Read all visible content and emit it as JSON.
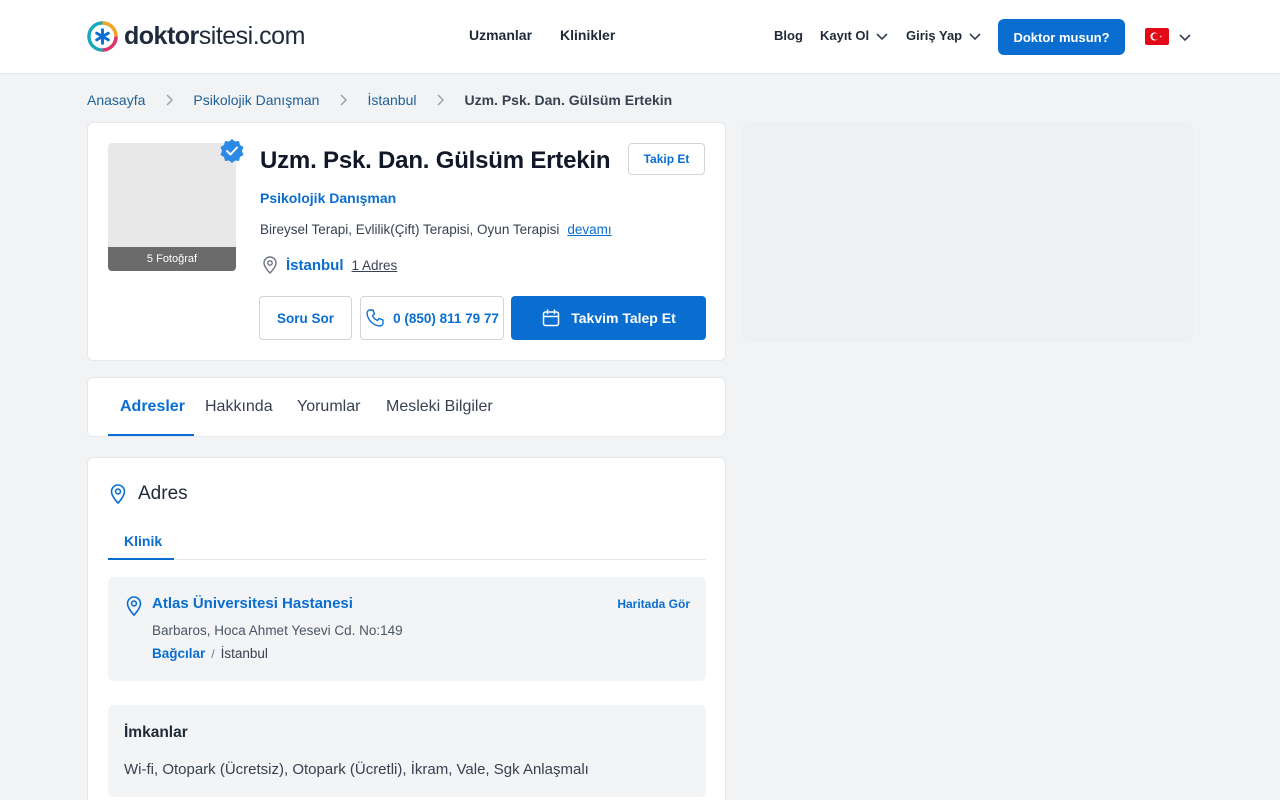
{
  "header": {
    "logo_bold": "doktor",
    "logo_thin": "sitesi.com",
    "nav_center": [
      "Uzmanlar",
      "Klinikler"
    ],
    "blog": "Blog",
    "register": "Kayıt Ol",
    "login": "Giriş Yap",
    "cta": "Doktor musun?",
    "language_flag": "tr-flag",
    "colors": {
      "brand": "#0a6ed1",
      "flag": "#e30a17"
    }
  },
  "breadcrumb": {
    "items": [
      "Anasayfa",
      "Psikolojik Danışman",
      "İstanbul"
    ],
    "current": "Uzm. Psk. Dan. Gülsüm Ertekin"
  },
  "profile": {
    "photo_count_label": "5 Fotoğraf",
    "name": "Uzm. Psk. Dan. Gülsüm Ertekin",
    "follow_label": "Takip Et",
    "specialty": "Psikolojik Danışman",
    "therapies": "Bireysel Terapi, Evlilik(Çift) Terapisi, Oyun Terapisi",
    "more_label": "devamı",
    "city": "İstanbul",
    "address_count": "1 Adres",
    "ask_label": "Soru Sor",
    "phone": "0 (850) 811 79 77",
    "calendar_label": "Takvim Talep Et"
  },
  "tabs": [
    "Adresler",
    "Hakkında",
    "Yorumlar",
    "Mesleki Bilgiler"
  ],
  "address": {
    "title": "Adres",
    "subtab": "Klinik",
    "clinic_name": "Atlas Üniversitesi Hastanesi",
    "map_link": "Haritada Gör",
    "street": "Barbaros, Hoca Ahmet Yesevi Cd. No:149",
    "district": "Bağcılar",
    "separator": "/",
    "city": "İstanbul",
    "amenities_title": "İmkanlar",
    "amenities": "Wi-fi, Otopark (Ücretsiz), Otopark (Ücretli), İkram, Vale, Sgk Anlaşmalı"
  }
}
